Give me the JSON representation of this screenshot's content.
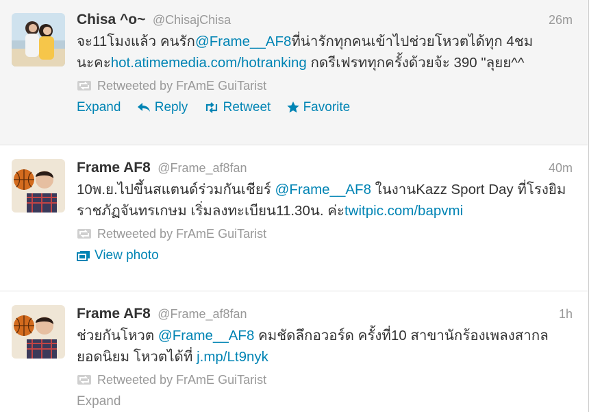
{
  "tweets": [
    {
      "fullname": "Chisa ^o~",
      "username": "@ChisajChisa",
      "time": "26m",
      "text_parts": {
        "p1": "จะ11โมงแล้ว คนรัก",
        "m1": "@Frame__AF8",
        "p2": "ที่น่ารักทุกคนเข้าไปช่วยโหวตได้ทุก 4ชม นะคะ",
        "l1": "hot.atimemedia.com/hotranking",
        "p3": " กดรีเฟรททุกครั้งด้วยจ้ะ 390 \"ลุยย^^"
      },
      "retweeted_by": "Retweeted by FrAmE GuiTarist",
      "actions": {
        "expand": "Expand",
        "reply": "Reply",
        "retweet": "Retweet",
        "favorite": "Favorite"
      }
    },
    {
      "fullname": "Frame AF8",
      "username": "@Frame_af8fan",
      "time": "40m",
      "text_parts": {
        "p1": "10พ.ย.ไปขึ้นสแตนด์ร่วมกันเชียร์ ",
        "m1": "@Frame__AF8",
        "p2": " ในงานKazz Sport Day ที่โรงยิมราชภัฏจันทรเกษม เริ่มลงทะเบียน11.30น. ค่ะ",
        "l1": "twitpic.com/bapvmi"
      },
      "retweeted_by": "Retweeted by FrAmE GuiTarist",
      "view_photo": "View photo"
    },
    {
      "fullname": "Frame AF8",
      "username": "@Frame_af8fan",
      "time": "1h",
      "text_parts": {
        "p1": "ช่วยกันโหวต ",
        "m1": "@Frame__AF8",
        "p2": " คมชัดลึกอวอร์ด ครั้งที่10 สาขานักร้องเพลงสากลยอดนิยม โหวตได้ที่ ",
        "l1": "j.mp/Lt9nyk"
      },
      "retweeted_by": "Retweeted by FrAmE GuiTarist",
      "expand": "Expand"
    }
  ],
  "colors": {
    "link": "#0084b4",
    "muted": "#999999",
    "text": "#333333",
    "highlight_bg": "#f5f5f5"
  },
  "icons": [
    "retweet-context-icon",
    "reply-icon",
    "retweet-icon",
    "favorite-star-icon",
    "view-photo-icon"
  ]
}
